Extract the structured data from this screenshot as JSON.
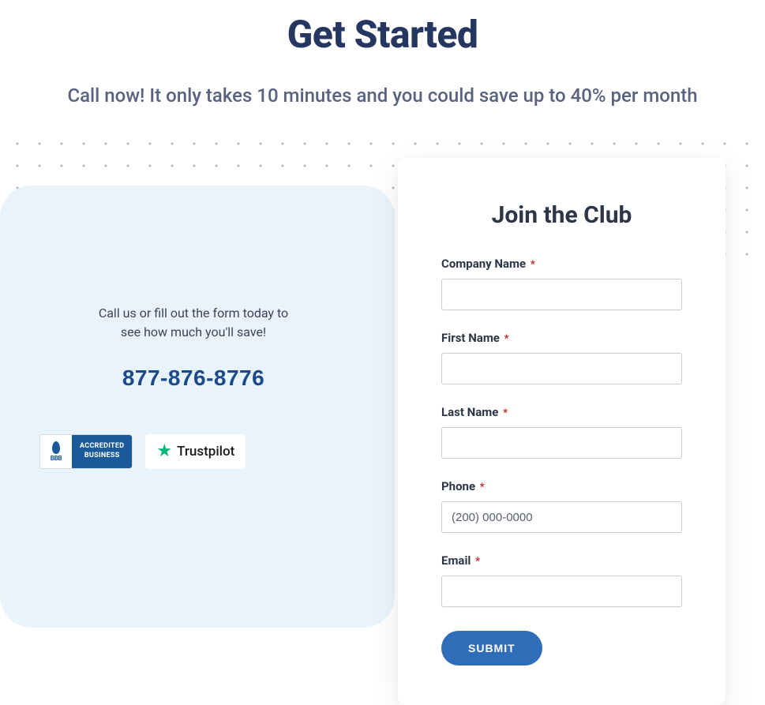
{
  "hero": {
    "title": "Get Started",
    "subtitle": "Call now! It only takes 10 minutes and you could save up to 40% per month"
  },
  "left": {
    "cta_text": "Call us or fill out the form today to see how much you'll save!",
    "phone": "877-876-8776",
    "bbb": {
      "org": "BBB",
      "line1": "ACCREDITED",
      "line2": "BUSINESS"
    },
    "trustpilot": {
      "label": "Trustpilot"
    }
  },
  "form": {
    "title": "Join the Club",
    "fields": {
      "company": {
        "label": "Company Name",
        "required": "*"
      },
      "first": {
        "label": "First Name",
        "required": "*"
      },
      "last": {
        "label": "Last Name",
        "required": "*"
      },
      "phone": {
        "label": "Phone",
        "required": "*",
        "placeholder": "(200) 000-0000"
      },
      "email": {
        "label": "Email",
        "required": "*"
      }
    },
    "submit_label": "SUBMIT"
  }
}
